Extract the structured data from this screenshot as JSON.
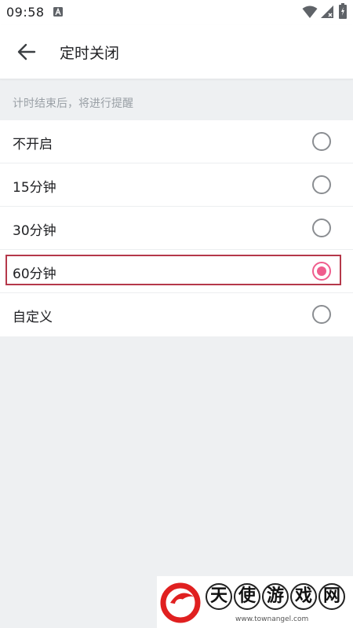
{
  "status_bar": {
    "time": "09:58"
  },
  "app_bar": {
    "title": "定时关闭"
  },
  "hint": "计时结束后，将进行提醒",
  "options": [
    {
      "label": "不开启",
      "selected": false
    },
    {
      "label": "15分钟",
      "selected": false
    },
    {
      "label": "30分钟",
      "selected": false
    },
    {
      "label": "60分钟",
      "selected": true
    },
    {
      "label": "自定义",
      "selected": false
    }
  ],
  "watermark": {
    "chars": [
      "天",
      "使",
      "游",
      "戏",
      "网"
    ],
    "url": "www.townangel.com"
  },
  "colors": {
    "accent": "#ef5d8d",
    "highlight": "#b5384a",
    "background": "#eef0f2"
  }
}
